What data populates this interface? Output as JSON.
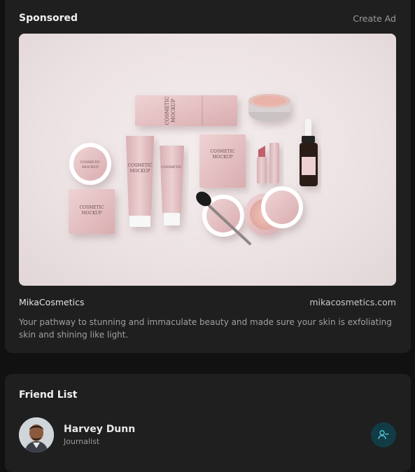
{
  "sponsored": {
    "title": "Sponsored",
    "create_ad_label": "Create Ad",
    "brand_name": "MikaCosmetics",
    "brand_url": "mikacosmetics.com",
    "description": "Your pathway to stunning and immaculate beauty and made sure your skin is exfoliating skin and shining like light.",
    "product_text": "COSMETIC MOCKUP"
  },
  "friend_list": {
    "title": "Friend List",
    "friends": [
      {
        "name": "Harvey Dunn",
        "role": "Journalist",
        "action_icon": "user-minus-icon"
      }
    ]
  },
  "colors": {
    "card_bg": "#1f1f1f",
    "page_bg": "#111111",
    "accent_button": "#123c45",
    "accent_icon": "#4fc3d7",
    "product_pink": "#e7c4c6"
  }
}
